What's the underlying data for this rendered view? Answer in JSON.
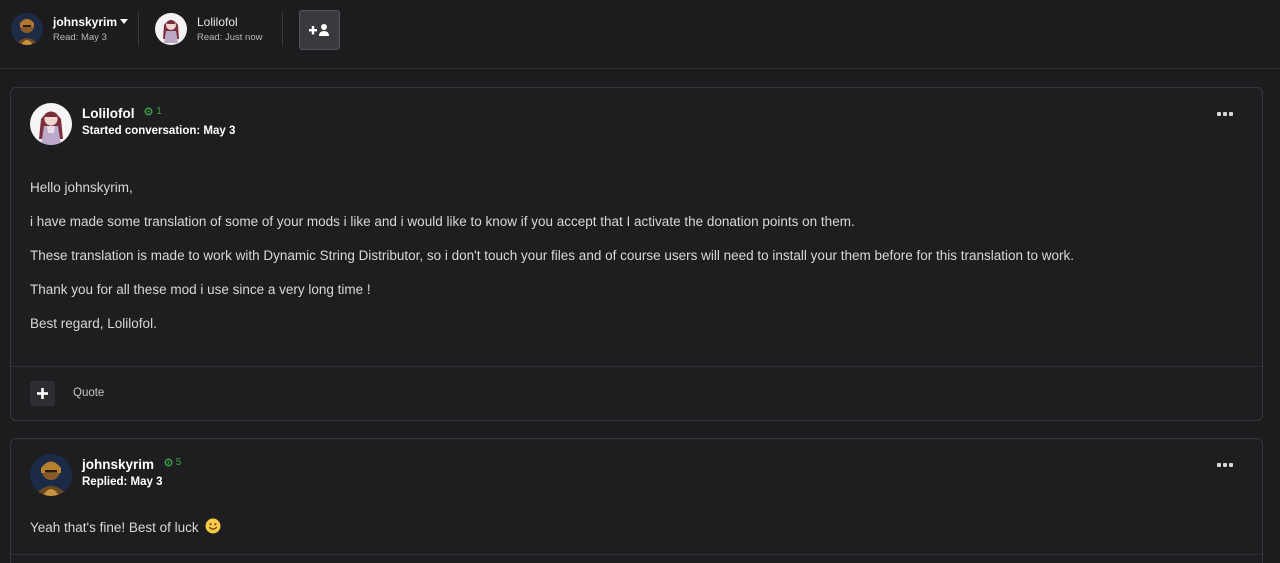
{
  "participants": [
    {
      "name": "johnskyrim",
      "read": "Read: May 3",
      "avatar": "knight-avatar"
    },
    {
      "name": "Lolilofol",
      "read": "Read: Just now",
      "avatar": "girl-avatar"
    }
  ],
  "add_participant_icon": "plus-user-icon",
  "posts": [
    {
      "author": "Lolilofol",
      "rank": "1",
      "meta": "Started conversation: May 3",
      "body": [
        "Hello johnskyrim,",
        "i have made some translation of some of your mods i like and i would like to know if you accept that I activate the donation points on them.",
        "These translation is made to work with Dynamic String Distributor, so i don't touch your files and of course users will need to install your them before for this translation to work.",
        "Thank you for all these mod i use since a very long time !",
        "Best regard, Lolilofol."
      ],
      "footer": {
        "quote_label": "Quote"
      }
    },
    {
      "author": "johnskyrim",
      "rank": "5",
      "meta": "Replied: May 3",
      "body": [
        "Yeah that's fine! Best of luck"
      ],
      "emoji": "smiley-emoji"
    }
  ],
  "colors": {
    "background": "#1c1c1e",
    "card": "#1e1e21",
    "rank_green": "#3aa34a"
  }
}
